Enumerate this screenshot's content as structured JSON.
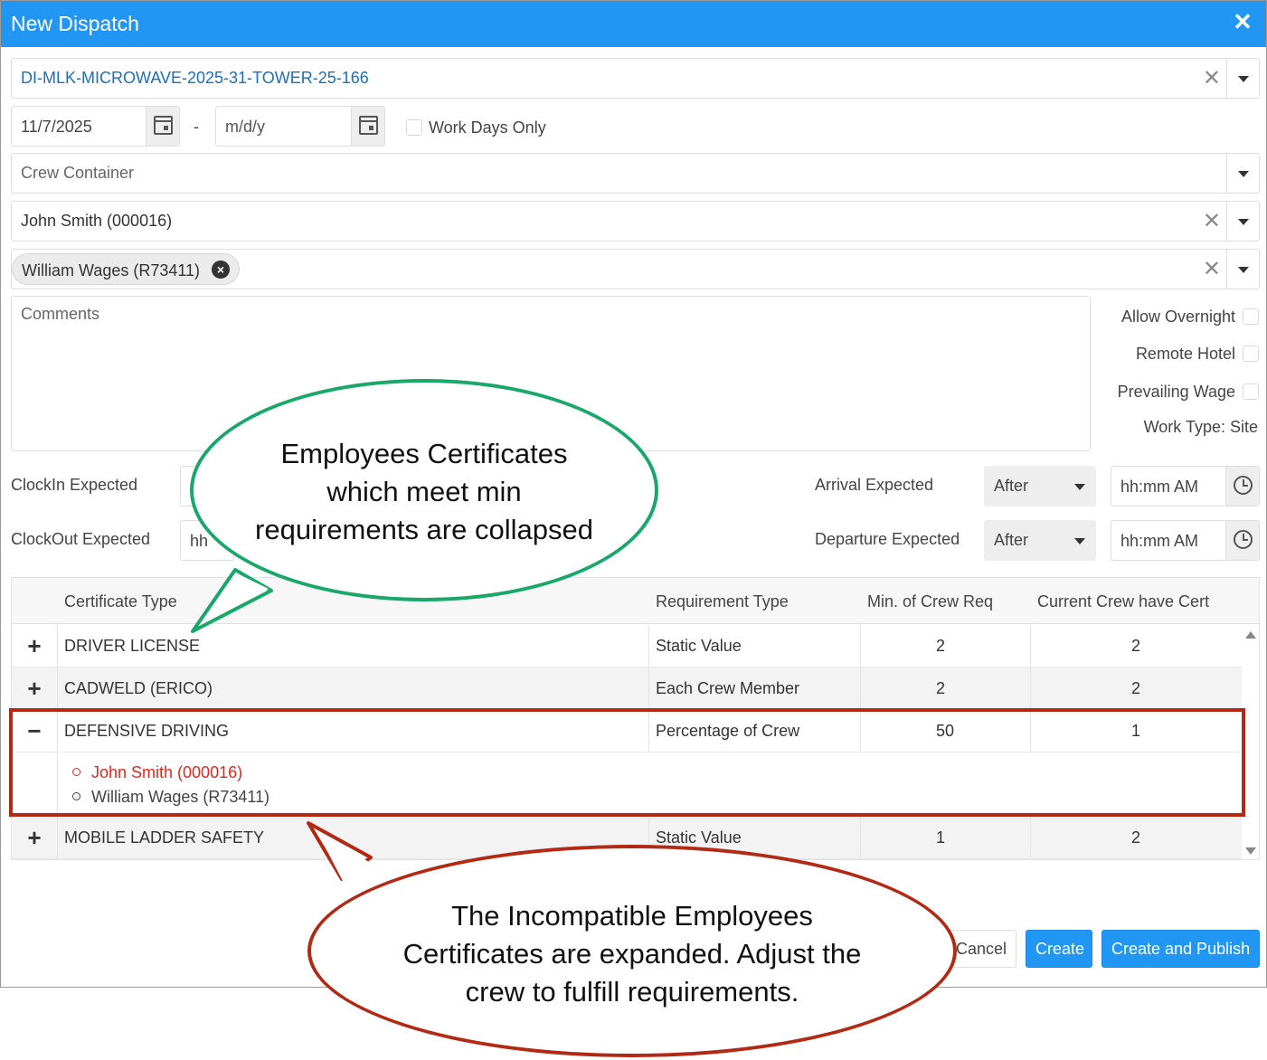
{
  "dialog": {
    "title": "New Dispatch",
    "close": "✕"
  },
  "job": {
    "value": "DI-MLK-MICROWAVE-2025-31-TOWER-25-166",
    "clear": "✕"
  },
  "dates": {
    "start": "11/7/2025",
    "separator": "-",
    "end_placeholder": "m/d/y",
    "work_days_label": "Work Days Only"
  },
  "crew_container": {
    "placeholder": "Crew Container"
  },
  "foreman": {
    "value": "John Smith (000016)",
    "clear": "✕"
  },
  "crew": {
    "chip": "William Wages (R73411)",
    "chip_remove": "×",
    "clear": "✕"
  },
  "comments": {
    "placeholder": "Comments"
  },
  "options": {
    "allow_overnight": "Allow Overnight",
    "remote_hotel": "Remote Hotel",
    "prevailing_wage": "Prevailing Wage",
    "work_type": "Work Type: Site"
  },
  "times": {
    "clockin_label": "ClockIn Expected",
    "clockout_label": "ClockOut Expected",
    "clockout_partial": "hh",
    "arrival_label": "Arrival Expected",
    "departure_label": "Departure Expected",
    "arrival_mode": "After",
    "departure_mode": "After",
    "time_placeholder": "hh:mm AM"
  },
  "grid": {
    "headers": [
      "Certificate Type",
      "Requirement Type",
      "Min. of Crew Req",
      "Current Crew have Cert"
    ],
    "rows": [
      {
        "toggle": "+",
        "cert": "DRIVER LICENSE",
        "req": "Static Value",
        "min": "2",
        "current": "2"
      },
      {
        "toggle": "+",
        "cert": "CADWELD (ERICO)",
        "req": "Each Crew Member",
        "min": "2",
        "current": "2"
      },
      {
        "toggle": "−",
        "cert": "DEFENSIVE DRIVING",
        "req": "Percentage of Crew",
        "min": "50",
        "current": "1"
      },
      {
        "toggle": "+",
        "cert": "MOBILE LADDER SAFETY",
        "req": "Static Value",
        "min": "1",
        "current": "2"
      }
    ],
    "detail": [
      {
        "name": "John Smith (000016)",
        "color": "#e8251b"
      },
      {
        "name": "William Wages (R73411)",
        "color": "#444444"
      }
    ]
  },
  "buttons": {
    "cancel": "Cancel",
    "create": "Create",
    "create_publish": "Create and Publish"
  },
  "callouts": {
    "green": [
      "Employees Certificates",
      "which meet min",
      "requirements are collapsed"
    ],
    "red": [
      "The Incompatible Employees",
      "Certificates are expanded. Adjust the",
      "crew to fulfill requirements."
    ]
  },
  "colors": {
    "header": "#2196f3",
    "link": "#1a6fbf",
    "green_callout": "#1aa86a",
    "red_callout": "#b22a14",
    "error_text": "#e8251b"
  }
}
